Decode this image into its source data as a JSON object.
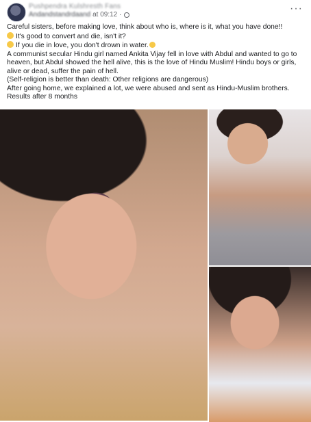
{
  "post": {
    "author_name": "Pushpendra Kulshresth Fans",
    "profile_line": "Andandstandrdaand",
    "time": "at 09:12 ·",
    "more_label": "···",
    "text": [
      "Careful sisters, before making love, think about who is, where is it, what you have done!!",
      "It's good to convert and die, isn't it?",
      "If you die in love, you don't drown in water.",
      "A communist secular Hindu girl named Ankita Vijay fell in love with Abdul and wanted to go to heaven, but Abdul showed the hell alive, this is the love of Hindu Muslim! Hindu boys or girls, alive or dead, suffer the pain of hell.",
      "(Self-religion is better than death: Other religions are dangerous)",
      "After going home, we explained a lot, we were abused and sent as Hindu-Muslim brothers.",
      "Results after 8 months"
    ]
  }
}
